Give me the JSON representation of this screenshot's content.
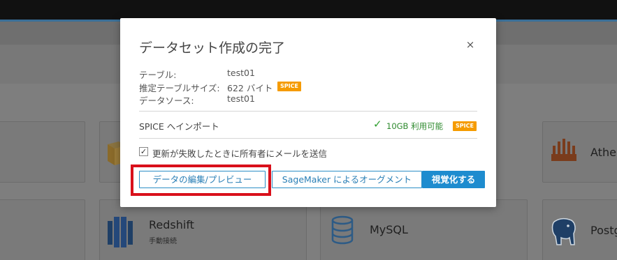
{
  "background": {
    "tiles": [
      {
        "name": "Redshift",
        "sub": "手動接続"
      },
      {
        "name": "MySQL"
      },
      {
        "name": "Athe"
      },
      {
        "name": "Postg"
      }
    ]
  },
  "modal": {
    "title": "データセット作成の完了",
    "close": "×",
    "details": [
      {
        "label": "テーブル:",
        "value": "test01"
      },
      {
        "label": "推定テーブルサイズ:",
        "value": "622 バイト",
        "badge": "SPICE"
      },
      {
        "label": "データソース:",
        "value": "test01"
      }
    ],
    "import": {
      "label": "SPICE へインポート",
      "check": "✓",
      "capacity": "10GB 利用可能",
      "badge": "SPICE"
    },
    "checkbox": {
      "mark": "✓",
      "label": "更新が失敗したときに所有者にメールを送信"
    },
    "buttons": {
      "edit_preview": "データの編集/プレビュー",
      "sagemaker": "SageMaker によるオーグメント",
      "visualize": "視覚化する"
    }
  },
  "colors": {
    "accent": "#1e8ccf",
    "spice_badge": "#f59b00",
    "available": "#2e9e2e",
    "highlight": "#d9101b"
  }
}
